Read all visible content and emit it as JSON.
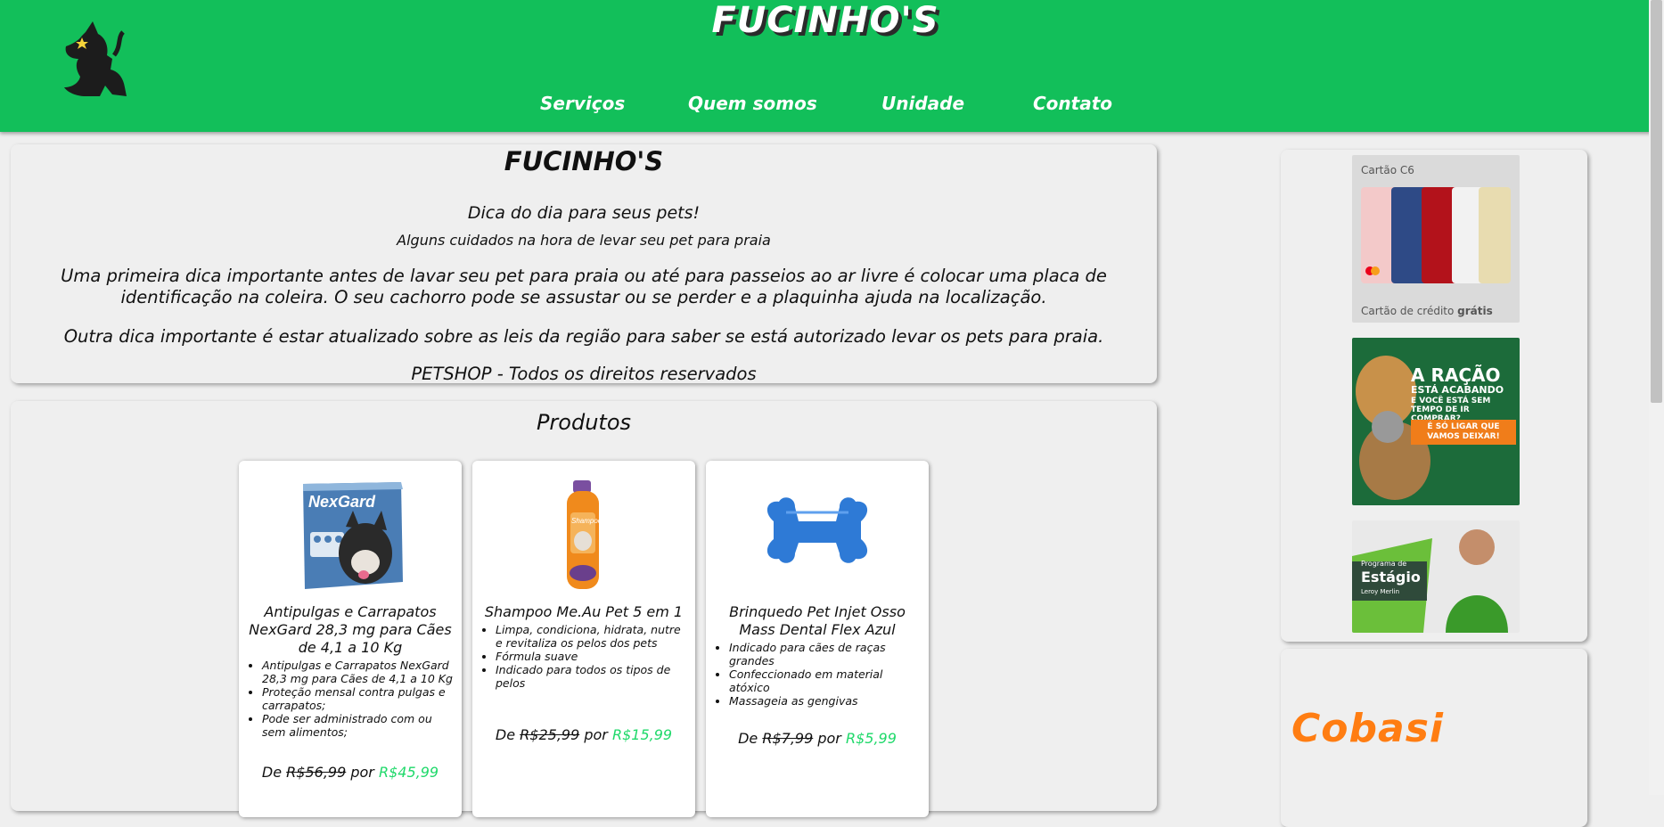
{
  "header": {
    "title": "FUCINHO'S",
    "nav": [
      "Serviços",
      "Quem somos",
      "Unidade",
      "Contato"
    ],
    "logo_icon": "dog-logo-icon"
  },
  "tip": {
    "title": "FUCINHO'S",
    "subtitle": "Dica do dia para seus pets!",
    "lead": "Alguns cuidados na hora de levar seu pet para praia",
    "paragraph1": "Uma primeira dica importante antes de lavar seu pet para praia ou até para passeios ao ar livre é colocar uma placa de identificação na coleira. O seu cachorro pode se assustar ou se perder e a plaquinha ajuda na localização.",
    "paragraph2": "Outra dica importante é estar atualizado sobre as leis da região para saber se está autorizado levar os pets para praia.",
    "footer": "PETSHOP - Todos os direitos reservados"
  },
  "products": {
    "title": "Produtos",
    "items": [
      {
        "name": "Antipulgas e Carrapatos NexGard 28,3 mg para Cães de 4,1 a 10 Kg",
        "bullets": [
          "Antipulgas e Carrapatos NexGard 28,3 mg para Cães de 4,1 a 10 Kg",
          "Proteção mensal contra pulgas e carrapatos;",
          "Pode ser administrado com ou sem alimentos;"
        ],
        "price_prefix": "De",
        "old_price": "R$56,99",
        "price_joiner": "por",
        "new_price": "R$45,99",
        "image_text": "NexGard"
      },
      {
        "name": "Shampoo Me.Au Pet 5 em 1",
        "bullets": [
          "Limpa, condiciona, hidrata, nutre e revitaliza os pelos dos pets",
          "Fórmula suave",
          "Indicado para todos os tipos de pelos"
        ],
        "price_prefix": "De",
        "old_price": "R$25,99",
        "price_joiner": "por",
        "new_price": "R$15,99",
        "image_text": "Shampoo"
      },
      {
        "name": "Brinquedo Pet Injet Osso Mass Dental Flex Azul",
        "bullets": [
          "Indicado para cães de raças grandes",
          "Confeccionado em material atóxico",
          "Massageia as gengivas"
        ],
        "price_prefix": "De",
        "old_price": "R$7,99",
        "price_joiner": "por",
        "new_price": "R$5,99"
      }
    ]
  },
  "ads": {
    "c6_brand": "Cartão C6",
    "c6_caption_prefix": "Cartão de crédito",
    "c6_caption_bold": "grátis",
    "racao_line1": "A RAÇÃO",
    "racao_line2": "ESTÁ ACABANDO",
    "racao_line3": "E VOCÊ ESTÁ SEM TEMPO DE IR COMPRAR?",
    "racao_cta": "É SÓ LIGAR QUE VAMOS DEIXAR!",
    "estagio_small": "Programa de",
    "estagio_big": "Estágio",
    "estagio_brand": "Leroy Merlin",
    "cobasi": "Cobasi"
  },
  "colors": {
    "header": "#12bf5a",
    "price_new": "#1fd96a",
    "cobasi": "#ff7d12"
  }
}
